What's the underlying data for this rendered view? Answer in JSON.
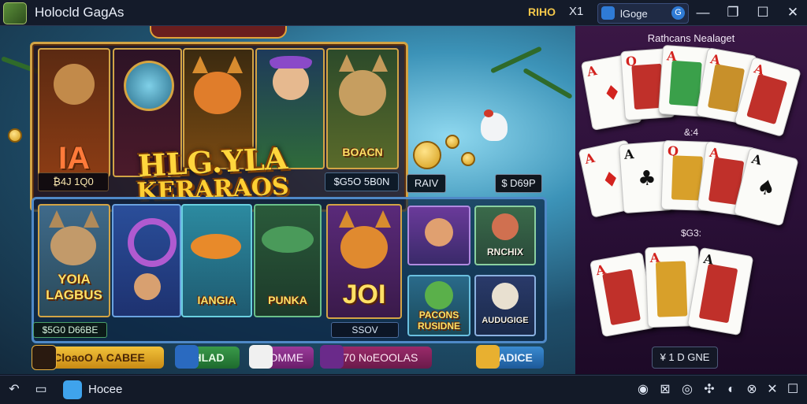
{
  "window": {
    "title": "Holocld GagAs",
    "status_label": "RIHO",
    "status_close": "X1",
    "search_value": "lGoge",
    "search_icon_text": "G",
    "min_glyph": "—",
    "restore_glyph": "❐",
    "max_glyph": "☐",
    "close_glyph": "✕"
  },
  "game": {
    "top_banner": "",
    "title": "HLG.YLA",
    "subtitle": "KERARAOS",
    "top_tiles": [
      {
        "label": "IA",
        "price": "₿4J 1Q0"
      },
      {
        "label": "BOACN",
        "price": "$G5O 5B0N"
      }
    ],
    "side_chips": [
      "RAIV",
      "$ D69P"
    ],
    "bottom_tiles": [
      {
        "label": "YOIA\nLAGBUS"
      },
      {
        "label": "IANGIA"
      },
      {
        "label": "PUNKA"
      },
      {
        "label": "JOI"
      },
      {
        "label": "RNCHIX"
      },
      {
        "label": "PACONS\nRUSIDNE"
      },
      {
        "label": "AUDUGIGE"
      }
    ],
    "bottom_chips": [
      "$5G0 D66BE",
      "SSOV"
    ],
    "buttons": [
      "CloaoO A CABEE",
      "HLAD",
      "FOMME",
      "$70 NoEOOLAS",
      "HADICE"
    ]
  },
  "side_panel": {
    "title": "Rathcans Nealaget",
    "label_1": "&:4",
    "label_2": "$G3:",
    "action": "¥ 1 D GNE"
  },
  "taskbar": {
    "back_glyph": "↶",
    "home_glyph": "▭",
    "app_label": "Hocee",
    "tray_icons": [
      "◉",
      "⊠",
      "◎",
      "✣",
      "◐",
      "⊗",
      "✕",
      "☐"
    ]
  },
  "colors": {
    "gold": "#d2a445",
    "frame_blue": "#4f89c7",
    "panel_purple": "#3a1745",
    "card_red": "#d3231f"
  }
}
